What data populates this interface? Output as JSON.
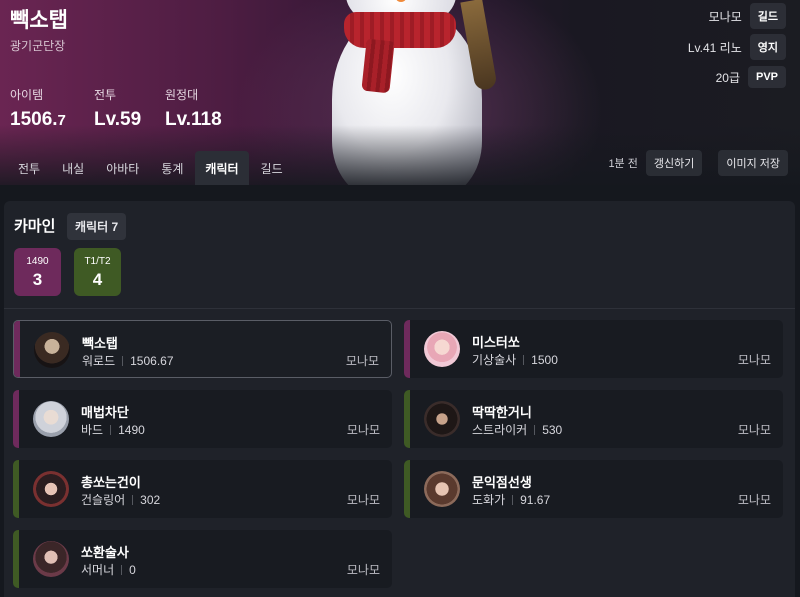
{
  "profile": {
    "name": "빽소탭",
    "title": "광기군단장",
    "stats": [
      {
        "label": "아이템",
        "value": "1506.",
        "value_small": "7"
      },
      {
        "label": "전투",
        "value": "Lv.59",
        "value_small": ""
      },
      {
        "label": "원정대",
        "value": "Lv.118",
        "value_small": ""
      }
    ],
    "meta": [
      {
        "text": "모나모",
        "badge": "길드"
      },
      {
        "text": "Lv.41 리노",
        "badge": "영지"
      },
      {
        "text": "20급",
        "badge": "PVP"
      }
    ]
  },
  "tabs": [
    {
      "label": "전투",
      "active": false
    },
    {
      "label": "내실",
      "active": false
    },
    {
      "label": "아바타",
      "active": false
    },
    {
      "label": "통계",
      "active": false
    },
    {
      "label": "캐릭터",
      "active": true
    },
    {
      "label": "길드",
      "active": false
    }
  ],
  "actions": {
    "updated": "1분 전",
    "refresh_label": "갱신하기",
    "save_image_label": "이미지 저장"
  },
  "server": {
    "name": "카마인",
    "count_badge": "캐릭터 7",
    "tiers": [
      {
        "label": "1490",
        "count": "3",
        "color": "#6e2a5c"
      },
      {
        "label": "T1/T2",
        "count": "4",
        "color": "#3f5a24"
      }
    ]
  },
  "characters": [
    {
      "name": "빽소탭",
      "class": "워로드",
      "level": "1506.67",
      "server": "모나모",
      "tier_color": "#6e2a5c",
      "selected": true,
      "avatar": "warlord-avatar"
    },
    {
      "name": "미스터쏘",
      "class": "기상술사",
      "level": "1500",
      "server": "모나모",
      "tier_color": "#6e2a5c",
      "selected": false,
      "avatar": "aeromancer-avatar"
    },
    {
      "name": "매법차단",
      "class": "바드",
      "level": "1490",
      "server": "모나모",
      "tier_color": "#6e2a5c",
      "selected": false,
      "avatar": "bard-avatar"
    },
    {
      "name": "딱딱한거니",
      "class": "스트라이커",
      "level": "530",
      "server": "모나모",
      "tier_color": "#3f5a24",
      "selected": false,
      "avatar": "striker-avatar"
    },
    {
      "name": "총쏘는건이",
      "class": "건슬링어",
      "level": "302",
      "server": "모나모",
      "tier_color": "#3f5a24",
      "selected": false,
      "avatar": "gunslinger-avatar"
    },
    {
      "name": "문익점선생",
      "class": "도화가",
      "level": "91.67",
      "server": "모나모",
      "tier_color": "#3f5a24",
      "selected": false,
      "avatar": "artist-avatar"
    },
    {
      "name": "쏘환술사",
      "class": "서머너",
      "level": "0",
      "server": "모나모",
      "tier_color": "#3f5a24",
      "selected": false,
      "avatar": "summoner-avatar"
    }
  ]
}
